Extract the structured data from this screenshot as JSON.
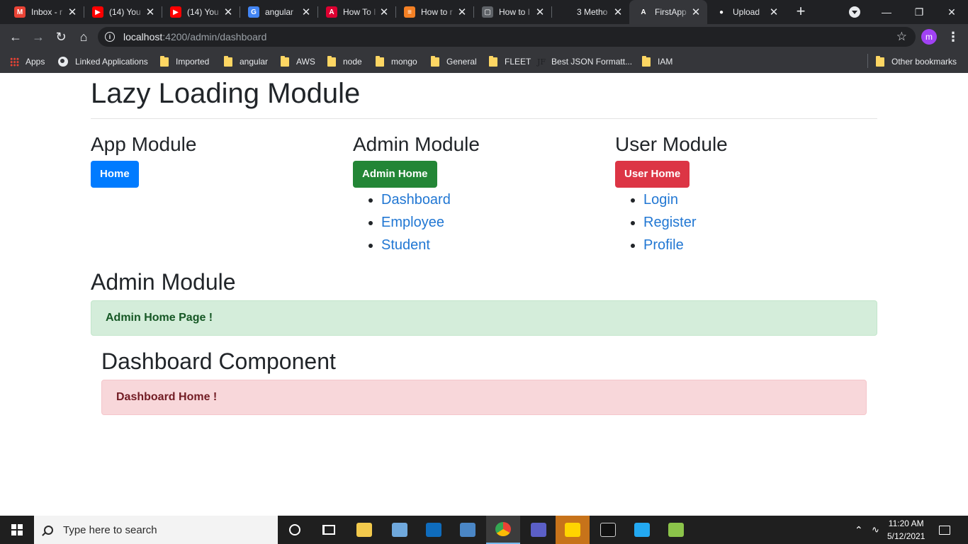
{
  "browser": {
    "tabs": [
      {
        "title": "Inbox - r",
        "favicon": "gmail-icon",
        "color": "#ea4335",
        "glyph": "M"
      },
      {
        "title": "(14) You",
        "favicon": "youtube-icon",
        "color": "#ff0000",
        "glyph": "▶"
      },
      {
        "title": "(14) You",
        "favicon": "youtube-icon",
        "color": "#ff0000",
        "glyph": "▶"
      },
      {
        "title": "angular",
        "favicon": "google-icon",
        "color": "#4285f4",
        "glyph": "G"
      },
      {
        "title": "How To I",
        "favicon": "angular-icon",
        "color": "#dd0031",
        "glyph": "A"
      },
      {
        "title": "How to r",
        "favicon": "stackoverflow-icon",
        "color": "#f48024",
        "glyph": "≡"
      },
      {
        "title": "How to I",
        "favicon": "doc-icon",
        "color": "#5f6368",
        "glyph": "▢"
      },
      {
        "title": "3 Metho",
        "favicon": "site-icon",
        "color": "#202124",
        "glyph": ""
      },
      {
        "title": "FirstApp",
        "favicon": "angular-icon",
        "color": "#35363a",
        "glyph": "A"
      },
      {
        "title": "Upload",
        "favicon": "github-icon",
        "color": "#202124",
        "glyph": "●"
      }
    ],
    "active_tab_index": 8,
    "new_tab_label": "+",
    "url_host": "localhost",
    "url_rest": ":4200/admin/dashboard",
    "profile_initial": "m",
    "bookmarks": [
      {
        "label": "Apps",
        "icon": "apps-grid-icon"
      },
      {
        "label": "Linked Applications",
        "icon": "globe-icon"
      },
      {
        "label": "Imported",
        "icon": "folder-icon"
      },
      {
        "label": "angular",
        "icon": "folder-icon"
      },
      {
        "label": "AWS",
        "icon": "folder-icon"
      },
      {
        "label": "node",
        "icon": "folder-icon"
      },
      {
        "label": "mongo",
        "icon": "folder-icon"
      },
      {
        "label": "General",
        "icon": "folder-icon"
      },
      {
        "label": "FLEET",
        "icon": "folder-icon"
      },
      {
        "label": "Best JSON Formatt...",
        "icon": "jf-icon"
      },
      {
        "label": "IAM",
        "icon": "folder-icon"
      }
    ],
    "other_bookmarks": "Other bookmarks"
  },
  "page": {
    "title": "Lazy Loading Module",
    "app_module": {
      "heading": "App Module",
      "button": "Home"
    },
    "admin_module": {
      "heading": "Admin Module",
      "button": "Admin Home",
      "links": [
        "Dashboard",
        "Employee",
        "Student"
      ]
    },
    "user_module": {
      "heading": "User Module",
      "button": "User Home",
      "links": [
        "Login",
        "Register",
        "Profile"
      ]
    },
    "admin_section": {
      "heading": "Admin Module",
      "alert": "Admin Home Page !"
    },
    "dashboard_section": {
      "heading": "Dashboard Component",
      "alert": "Dashboard Home !"
    }
  },
  "taskbar": {
    "search_placeholder": "Type here to search",
    "time": "11:20 AM",
    "date": "5/12/2021"
  }
}
